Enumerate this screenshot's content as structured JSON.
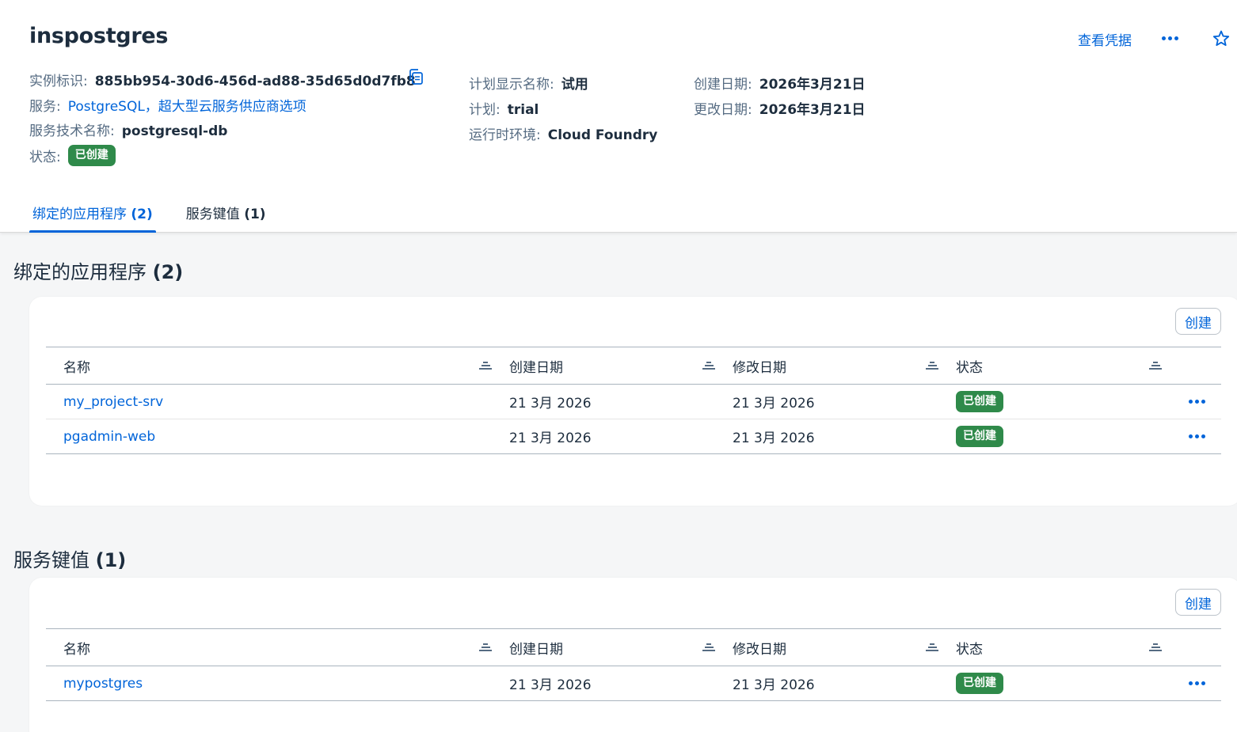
{
  "header": {
    "title": "inspostgres",
    "view_credentials": "查看凭据",
    "fields_left": {
      "instance_id_label": "实例标识:",
      "instance_id": "885bb954-30d6-456d-ad88-35d65d0d7fb8",
      "service_label": "服务:",
      "service": "PostgreSQL，超大型云服务供应商选项",
      "tech_name_label": "服务技术名称:",
      "tech_name": "postgresql-db",
      "status_label": "状态:",
      "status": "已创建"
    },
    "fields_mid": {
      "plan_display_label": "计划显示名称:",
      "plan_display": "试用",
      "plan_label": "计划:",
      "plan": "trial",
      "runtime_label": "运行时环境:",
      "runtime": "Cloud Foundry"
    },
    "fields_right": {
      "created_label": "创建日期:",
      "created": "2026年3月21日",
      "modified_label": "更改日期:",
      "modified": "2026年3月21日"
    },
    "tabs": [
      {
        "label": "绑定的应用程序",
        "count": "(2)"
      },
      {
        "label": "服务键值",
        "count": "(1)"
      }
    ]
  },
  "bound_apps": {
    "title": "绑定的应用程序",
    "count": "(2)",
    "create_label": "创建",
    "columns": [
      "名称",
      "创建日期",
      "修改日期",
      "状态"
    ],
    "rows": [
      {
        "name": "my_project-srv",
        "created": "21 3月 2026",
        "modified": "21 3月 2026",
        "status": "已创建"
      },
      {
        "name": "pgadmin-web",
        "created": "21 3月 2026",
        "modified": "21 3月 2026",
        "status": "已创建"
      }
    ]
  },
  "service_keys": {
    "title": "服务键值",
    "count": "(1)",
    "create_label": "创建",
    "columns": [
      "名称",
      "创建日期",
      "修改日期",
      "状态"
    ],
    "rows": [
      {
        "name": "mypostgres",
        "created": "21 3月 2026",
        "modified": "21 3月 2026",
        "status": "已创建"
      }
    ]
  },
  "colors": {
    "accent": "#0064d9",
    "success": "#2f8a4a",
    "label": "#556b82"
  }
}
